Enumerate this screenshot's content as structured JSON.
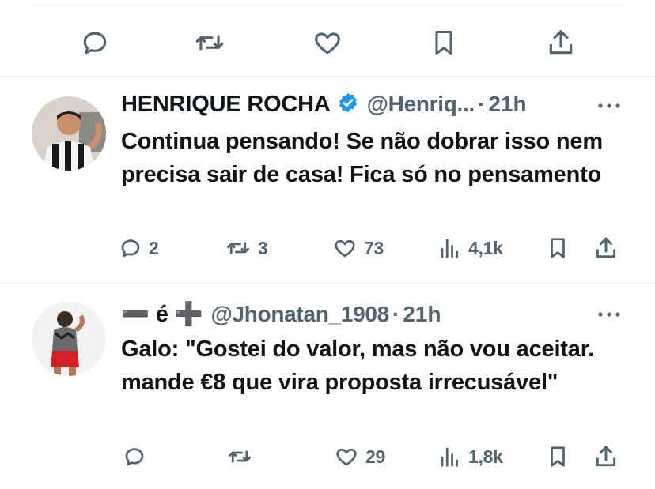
{
  "top_actions": {
    "reply_icon": "reply-icon",
    "retweet_icon": "retweet-icon",
    "like_icon": "heart-icon",
    "bookmark_icon": "bookmark-icon",
    "share_icon": "share-icon"
  },
  "tweets": [
    {
      "name": "HENRIQUE ROCHA",
      "verified": true,
      "handle": "@Henriq...",
      "separator": "·",
      "time": "21h",
      "text": "Continua pensando! Se não dobrar isso nem precisa sair de casa! Fica só no pensamento",
      "replies": "2",
      "retweets": "3",
      "likes": "73",
      "views": "4,1k"
    },
    {
      "name": "➖ é ➕",
      "verified": false,
      "handle": "@Jhonatan_1908",
      "separator": "·",
      "time": "21h",
      "text": "Galo: \"Gostei do valor, mas não vou aceitar. mande €8 que vira proposta irrecusável\"",
      "replies": "",
      "retweets": "",
      "likes": "29",
      "views": "1,8k"
    }
  ],
  "colors": {
    "text": "#0f1419",
    "muted": "#536471",
    "verified_blue": "#1d9bf0",
    "divider": "#eff3f4"
  }
}
